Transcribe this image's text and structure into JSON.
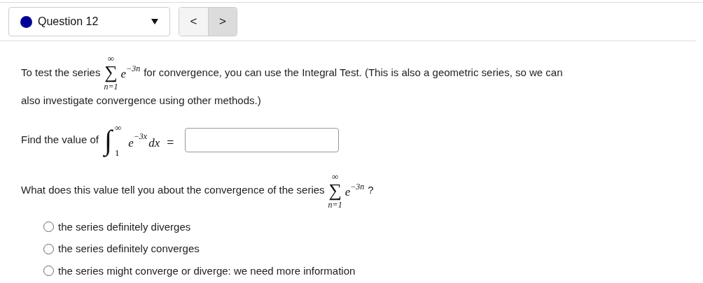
{
  "question_selector": {
    "label": "Question 12",
    "color": "#000099"
  },
  "nav_buttons": [
    {
      "label": "<",
      "highlighted": false
    },
    {
      "label": ">",
      "highlighted": true
    }
  ],
  "intro": [
    {
      "kind": "text",
      "text": "To test the series"
    },
    {
      "kind": "sum",
      "symbol": "∑",
      "upper": "∞",
      "lower": "n=1",
      "term": "e",
      "exponent": "−3n"
    },
    {
      "kind": "text",
      "text": "for convergence, you can use the Integral Test. (This is also a geometric series, so we can"
    },
    {
      "kind": "line",
      "text": "also investigate convergence using other methods.)"
    }
  ],
  "integral_prompt": [
    {
      "kind": "text",
      "text": "Find the value of"
    },
    {
      "kind": "integral",
      "symbol": "∫",
      "upper": "∞",
      "lower": "1",
      "term": "e",
      "exponent": "−3x",
      "differential": "dx",
      "equals": "="
    },
    {
      "kind": "field"
    }
  ],
  "question": [
    {
      "kind": "text",
      "text": "What does this value tell you about the convergence of the series"
    },
    {
      "kind": "sum",
      "symbol": "∑",
      "upper": "∞",
      "lower": "n=1",
      "term": "e",
      "exponent": "−3n"
    },
    {
      "kind": "text",
      "text": "?"
    }
  ],
  "options": [
    {
      "label": "the series definitely diverges",
      "selected": false
    },
    {
      "label": "the series definitely converges",
      "selected": false
    },
    {
      "label": "the series might converge or diverge: we need more information",
      "selected": false
    }
  ]
}
